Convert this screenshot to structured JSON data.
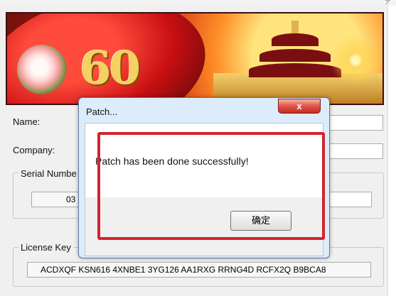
{
  "corner": "ア",
  "banner": {
    "number": "60"
  },
  "form": {
    "name_label": "Name:",
    "company_label": "Company:",
    "serial_group_label": "Serial Numbe",
    "serial_value": "03",
    "license_group_label": "License Key",
    "license_value": "ACDXQF KSN616 4XNBE1 3YG126 AA1RXG RRNG4D RCFX2Q B9BCA8"
  },
  "dialog": {
    "title": "Patch...",
    "close_label": "x",
    "message": "Patch has been done successfully!",
    "ok_label": "确定"
  },
  "colors": {
    "highlight": "#d5232b",
    "close_button": "#d94a3f",
    "dialog_frame": "#dcecfb"
  }
}
